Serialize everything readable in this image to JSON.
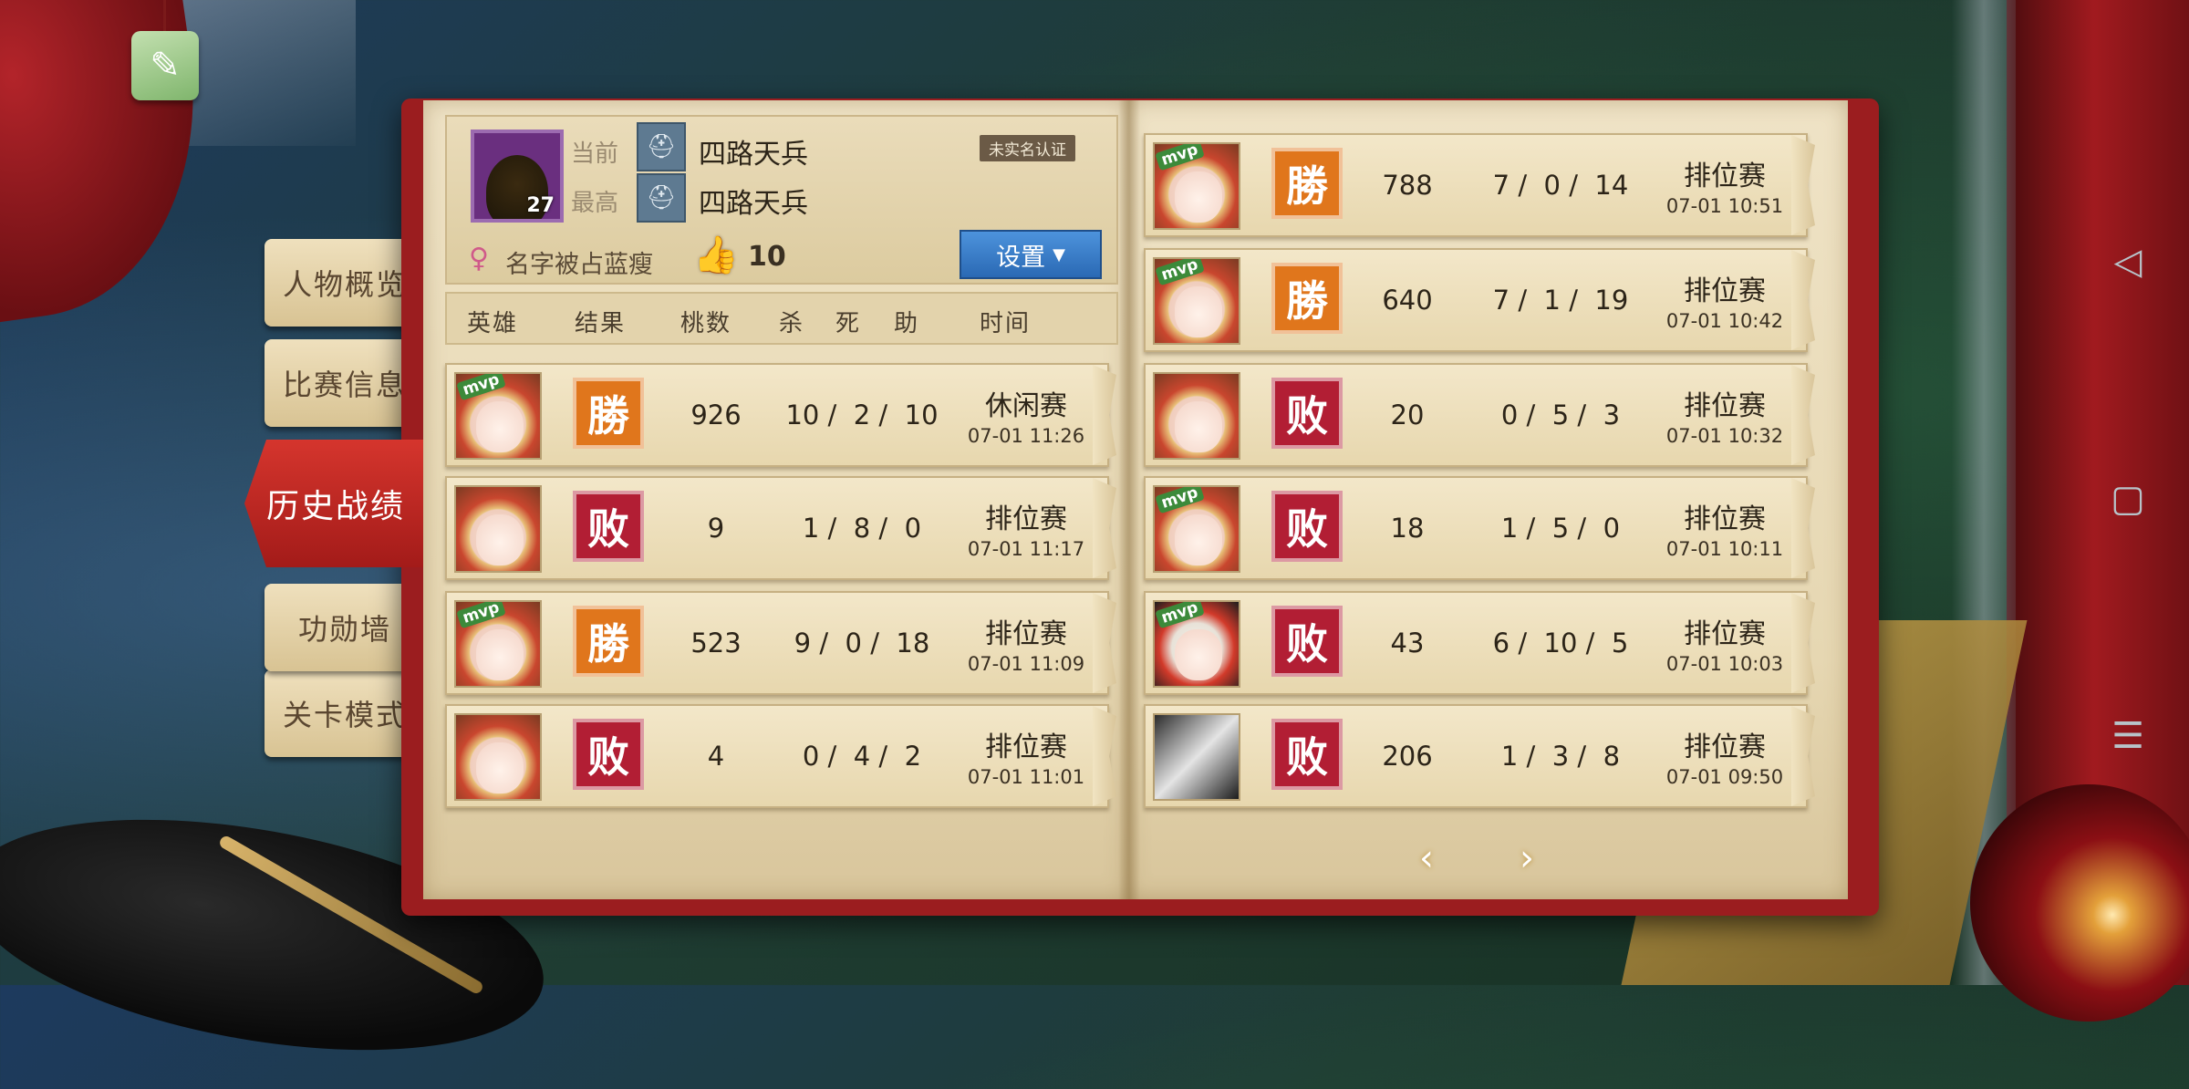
{
  "side_nav": [
    {
      "label": "人物概览",
      "active": false
    },
    {
      "label": "比赛信息",
      "active": false
    },
    {
      "label": "历史战绩",
      "active": true
    },
    {
      "label": "功勋墙",
      "active": false
    },
    {
      "label": "关卡模式",
      "active": false
    }
  ],
  "profile": {
    "level": "27",
    "current_label": "当前",
    "current_rank": "四路天兵",
    "highest_label": "最高",
    "highest_rank": "四路天兵",
    "verification": "未实名认证",
    "nickname": "名字被占蓝瘦",
    "likes": "10",
    "settings_label": "设置"
  },
  "columns": [
    "英雄",
    "结果",
    "桃数",
    "杀",
    "死",
    "助",
    "时间"
  ],
  "matches_left": [
    {
      "mvp": true,
      "result": "win",
      "result_text": "勝",
      "peaches": "926",
      "kda": "10 /  2 /  10",
      "mode": "休闲赛",
      "time": "07-01 11:26"
    },
    {
      "mvp": false,
      "result": "loss",
      "result_text": "败",
      "peaches": "9",
      "kda": "1 /  8 /  0",
      "mode": "排位赛",
      "time": "07-01 11:17"
    },
    {
      "mvp": true,
      "result": "win",
      "result_text": "勝",
      "peaches": "523",
      "kda": "9 /  0 /  18",
      "mode": "排位赛",
      "time": "07-01 11:09"
    },
    {
      "mvp": false,
      "result": "loss",
      "result_text": "败",
      "peaches": "4",
      "kda": "0 /  4 /  2",
      "mode": "排位赛",
      "time": "07-01 11:01"
    }
  ],
  "matches_right": [
    {
      "mvp": true,
      "result": "win",
      "result_text": "勝",
      "peaches": "788",
      "kda": "7 /  0 /  14",
      "mode": "排位赛",
      "time": "07-01 10:51"
    },
    {
      "mvp": true,
      "result": "win",
      "result_text": "勝",
      "peaches": "640",
      "kda": "7 /  1 /  19",
      "mode": "排位赛",
      "time": "07-01 10:42"
    },
    {
      "mvp": false,
      "result": "loss",
      "result_text": "败",
      "peaches": "20",
      "kda": "0 /  5 /  3",
      "mode": "排位赛",
      "time": "07-01 10:32"
    },
    {
      "mvp": true,
      "result": "loss",
      "result_text": "败",
      "peaches": "18",
      "kda": "1 /  5 /  0",
      "mode": "排位赛",
      "time": "07-01 10:11"
    },
    {
      "mvp": true,
      "result": "loss",
      "result_text": "败",
      "peaches": "43",
      "kda": "6 /  10 /  5",
      "mode": "排位赛",
      "time": "07-01 10:03"
    },
    {
      "mvp": false,
      "result": "loss",
      "result_text": "败",
      "peaches": "206",
      "kda": "1 /  3 /  8",
      "mode": "排位赛",
      "time": "07-01 09:50"
    }
  ],
  "mvp_badge": "mvp",
  "pager": {
    "prev": "‹",
    "next": "›"
  },
  "colors": {
    "win": "#e0761c",
    "loss": "#b21e34",
    "active_tab": "#c62a26",
    "settings": "#3a7fcc"
  }
}
